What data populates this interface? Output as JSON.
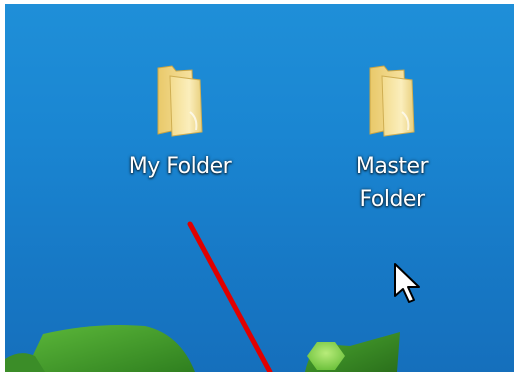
{
  "desktop": {
    "icons": [
      {
        "label": "My Folder",
        "icon": "folder-icon"
      },
      {
        "label": "Master\nFolder",
        "icon": "folder-icon"
      }
    ]
  },
  "colors": {
    "desktop_blue": "#1a86d2",
    "folder_yellow": "#f2d98a",
    "annotation_red": "#e00000",
    "wallpaper_green": "#3f9a2a"
  },
  "cursor": {
    "icon": "arrow-cursor-icon"
  },
  "annotation": {
    "icon": "red-arrow-line"
  }
}
